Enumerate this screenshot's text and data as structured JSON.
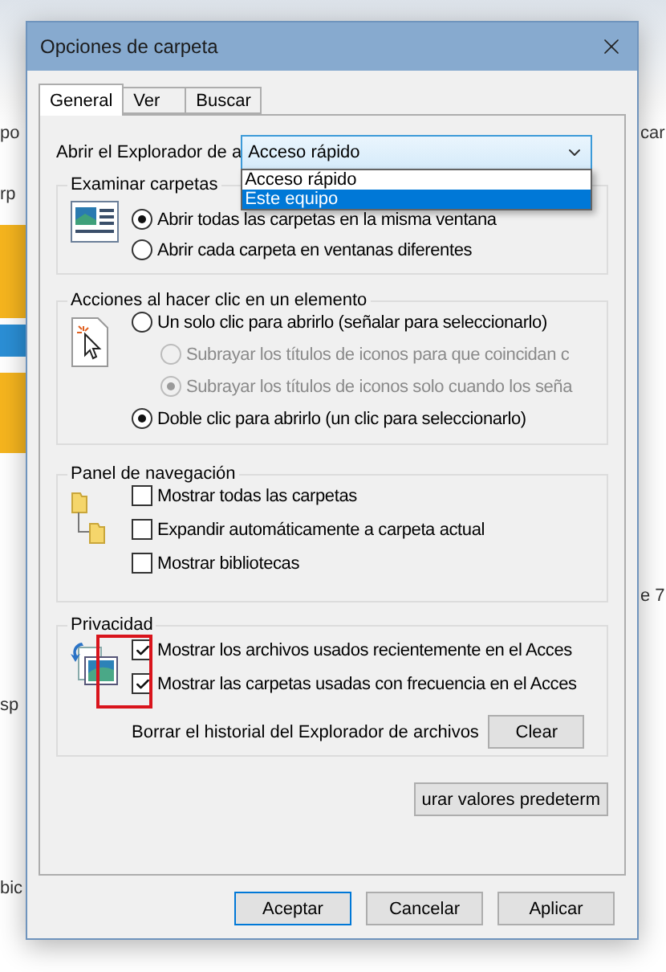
{
  "background": {
    "left_fragments": [
      "po",
      "rp",
      "sp",
      "bic"
    ],
    "right_fragments": [
      "car",
      "e 7"
    ]
  },
  "window": {
    "title": "Opciones de carpeta"
  },
  "tabs": [
    {
      "label": "General",
      "selected": true
    },
    {
      "label": "Ver",
      "selected": false
    },
    {
      "label": "Buscar",
      "selected": false
    }
  ],
  "open_in": {
    "label": "Abrir el Explorador de a",
    "value": "Acceso rápido",
    "expanded": true,
    "options": [
      {
        "label": "Acceso rápido",
        "highlighted": false
      },
      {
        "label": "Este equipo",
        "highlighted": true
      }
    ]
  },
  "groups": [
    {
      "title": "Examinar carpetas",
      "options": [
        {
          "kind": "radio",
          "label": "Abrir todas las carpetas en la misma ventana",
          "checked": true,
          "disabled": false
        },
        {
          "kind": "radio",
          "label": "Abrir cada carpeta en ventanas diferentes",
          "checked": false,
          "disabled": false
        }
      ]
    },
    {
      "title": "Acciones al hacer clic en un elemento",
      "options": [
        {
          "kind": "radio",
          "label": "Un solo clic para abrirlo (señalar para seleccionarlo)",
          "checked": false,
          "disabled": false,
          "children": [
            {
              "kind": "radio",
              "label": "Subrayar los títulos de iconos para que coincidan c",
              "checked": false,
              "disabled": true
            },
            {
              "kind": "radio",
              "label": "Subrayar los títulos de iconos solo cuando los seña",
              "checked": true,
              "disabled": true
            }
          ]
        },
        {
          "kind": "radio",
          "label": "Doble clic para abrirlo (un clic para seleccionarlo)",
          "checked": true,
          "disabled": false
        }
      ]
    },
    {
      "title": "Panel de navegación",
      "options": [
        {
          "kind": "checkbox",
          "label": "Mostrar todas las carpetas",
          "checked": false,
          "disabled": false
        },
        {
          "kind": "checkbox",
          "label": "Expandir automáticamente a carpeta actual",
          "checked": false,
          "disabled": false
        },
        {
          "kind": "checkbox",
          "label": "Mostrar bibliotecas",
          "checked": false,
          "disabled": false
        }
      ]
    },
    {
      "title": "Privacidad",
      "options": [
        {
          "kind": "checkbox",
          "label": "Mostrar los archivos usados recientemente en el Acces",
          "checked": true,
          "disabled": false
        },
        {
          "kind": "checkbox",
          "label": "Mostrar las carpetas usadas con frecuencia en el Acces",
          "checked": true,
          "disabled": false
        }
      ],
      "clear_row": {
        "label": "Borrar el historial del Explorador de archivos",
        "button": "Clear"
      }
    }
  ],
  "restore_button": "urar valores predeterm",
  "buttons": [
    {
      "label": "Aceptar",
      "default": true
    },
    {
      "label": "Cancelar",
      "default": false
    },
    {
      "label": "Aplicar",
      "default": false
    }
  ]
}
